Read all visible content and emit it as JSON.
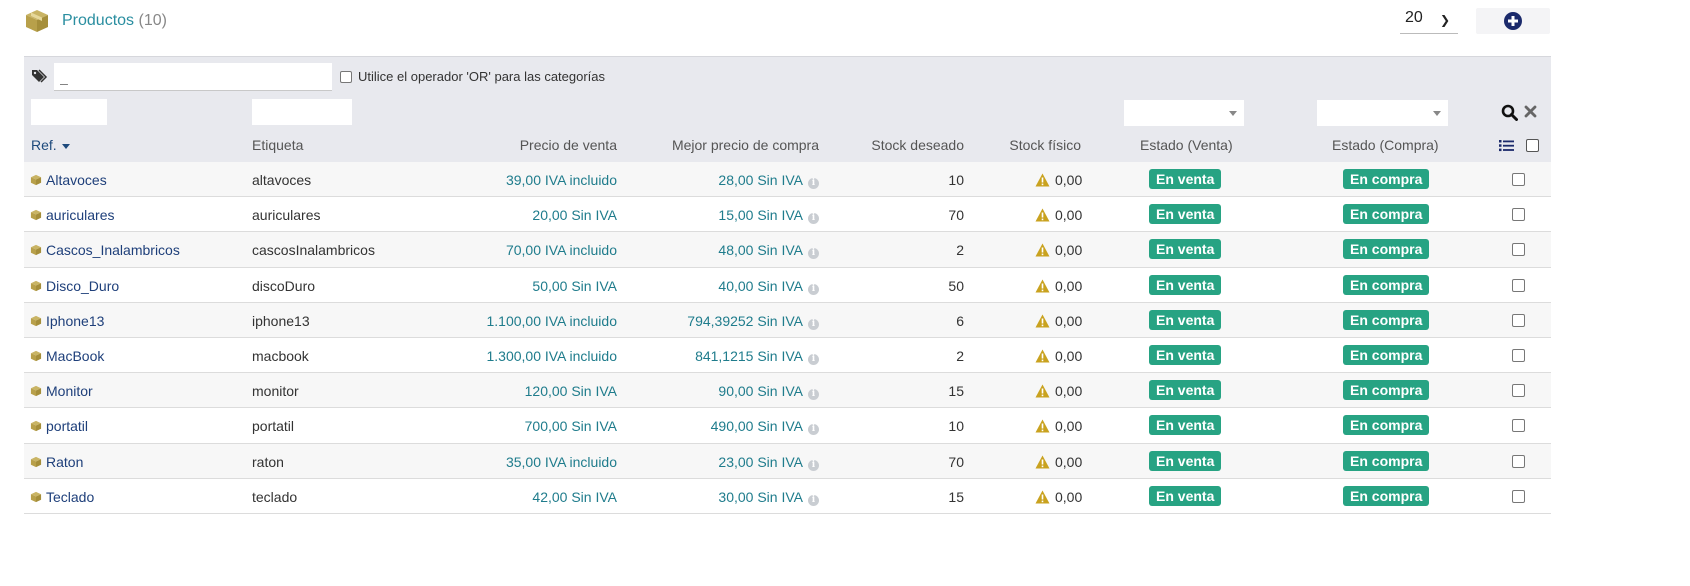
{
  "header": {
    "title": "Productos",
    "count": "(10)",
    "limit_value": "20",
    "add_icon": "plus-circle-icon",
    "title_icon": "cube-icon"
  },
  "filters": {
    "tag_placeholder": "_",
    "or_label": "Utilice el operador 'OR' para las categorías"
  },
  "columns": {
    "ref": "Ref.",
    "label": "Etiqueta",
    "sell_price": "Precio de venta",
    "best_buy_price": "Mejor precio de compra",
    "desired_stock": "Stock deseado",
    "physical_stock": "Stock físico",
    "status_sell": "Estado (Venta)",
    "status_buy": "Estado (Compra)"
  },
  "colors": {
    "accent": "#2a8ea0",
    "badge": "#27a383",
    "link": "#1e3f7a",
    "warning": "#c9a21f",
    "icon_gold": "#b8a04a"
  },
  "rows": [
    {
      "ref": "Altavoces",
      "label": "altavoces",
      "sell": "39,00 IVA incluido",
      "buy": "28,00 Sin IVA",
      "want": "10",
      "stock": "0,00",
      "status_sell": "En venta",
      "status_buy": "En compra"
    },
    {
      "ref": "auriculares",
      "label": "auriculares",
      "sell": "20,00 Sin IVA",
      "buy": "15,00 Sin IVA",
      "want": "70",
      "stock": "0,00",
      "status_sell": "En venta",
      "status_buy": "En compra"
    },
    {
      "ref": "Cascos_Inalambricos",
      "label": "cascosInalambricos",
      "sell": "70,00 IVA incluido",
      "buy": "48,00 Sin IVA",
      "want": "2",
      "stock": "0,00",
      "status_sell": "En venta",
      "status_buy": "En compra"
    },
    {
      "ref": "Disco_Duro",
      "label": "discoDuro",
      "sell": "50,00 Sin IVA",
      "buy": "40,00 Sin IVA",
      "want": "50",
      "stock": "0,00",
      "status_sell": "En venta",
      "status_buy": "En compra"
    },
    {
      "ref": "Iphone13",
      "label": "iphone13",
      "sell": "1.100,00 IVA incluido",
      "buy": "794,39252 Sin IVA",
      "want": "6",
      "stock": "0,00",
      "status_sell": "En venta",
      "status_buy": "En compra"
    },
    {
      "ref": "MacBook",
      "label": "macbook",
      "sell": "1.300,00 IVA incluido",
      "buy": "841,1215 Sin IVA",
      "want": "2",
      "stock": "0,00",
      "status_sell": "En venta",
      "status_buy": "En compra"
    },
    {
      "ref": "Monitor",
      "label": "monitor",
      "sell": "120,00 Sin IVA",
      "buy": "90,00 Sin IVA",
      "want": "15",
      "stock": "0,00",
      "status_sell": "En venta",
      "status_buy": "En compra"
    },
    {
      "ref": "portatil",
      "label": "portatil",
      "sell": "700,00 Sin IVA",
      "buy": "490,00 Sin IVA",
      "want": "10",
      "stock": "0,00",
      "status_sell": "En venta",
      "status_buy": "En compra"
    },
    {
      "ref": "Raton",
      "label": "raton",
      "sell": "35,00 IVA incluido",
      "buy": "23,00 Sin IVA",
      "want": "70",
      "stock": "0,00",
      "status_sell": "En venta",
      "status_buy": "En compra"
    },
    {
      "ref": "Teclado",
      "label": "teclado",
      "sell": "42,00 Sin IVA",
      "buy": "30,00 Sin IVA",
      "want": "15",
      "stock": "0,00",
      "status_sell": "En venta",
      "status_buy": "En compra"
    }
  ]
}
